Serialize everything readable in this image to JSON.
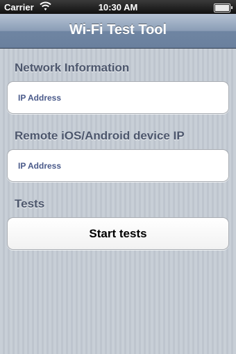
{
  "status_bar": {
    "carrier": "Carrier",
    "time": "10:30 AM"
  },
  "nav_bar": {
    "title": "Wi-Fi Test Tool"
  },
  "sections": {
    "network_info": {
      "label": "Network Information",
      "placeholder": "IP Address"
    },
    "remote_device": {
      "label": "Remote iOS/Android device IP",
      "placeholder": "IP Address"
    },
    "tests": {
      "label": "Tests",
      "button_label": "Start tests"
    }
  },
  "icons": [
    "wifi-icon",
    "battery-icon"
  ],
  "colors": {
    "nav_bar": "#8a9db6",
    "background": "#c5ccd4",
    "section_label": "#4c566c",
    "placeholder": "#4a5a8a"
  }
}
